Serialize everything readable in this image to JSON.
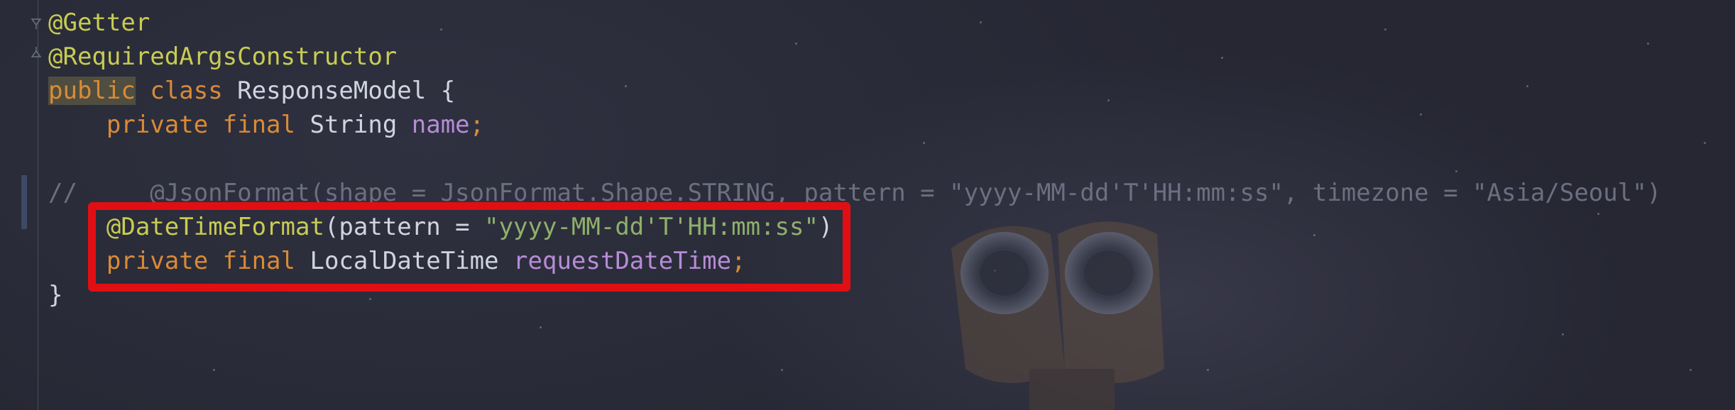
{
  "editor": {
    "lines": [
      [
        {
          "t": "@Getter",
          "c": "ann"
        }
      ],
      [
        {
          "t": "@RequiredArgsConstructor",
          "c": "ann"
        }
      ],
      [
        {
          "t": "public",
          "c": "kw kw-hl"
        },
        {
          "t": " ",
          "c": "plain"
        },
        {
          "t": "class",
          "c": "kw"
        },
        {
          "t": " ResponseModel {",
          "c": "plain"
        }
      ],
      [
        {
          "t": "    ",
          "c": "plain"
        },
        {
          "t": "private final",
          "c": "kw"
        },
        {
          "t": " String ",
          "c": "plain"
        },
        {
          "t": "name",
          "c": "fld"
        },
        {
          "t": ";",
          "c": "kw"
        }
      ],
      [
        {
          "t": "",
          "c": "plain"
        }
      ],
      [
        {
          "t": "//     @JsonFormat(shape = JsonFormat.Shape.STRING, pattern = \"yyyy-MM-dd'T'HH:mm:ss\", timezone = \"Asia/Seoul\")",
          "c": "cmt"
        }
      ],
      [
        {
          "t": "    ",
          "c": "plain"
        },
        {
          "t": "@DateTimeFormat",
          "c": "ann"
        },
        {
          "t": "(pattern = ",
          "c": "plain"
        },
        {
          "t": "\"yyyy-MM-dd'T'HH:mm:ss\"",
          "c": "str"
        },
        {
          "t": ")",
          "c": "plain"
        }
      ],
      [
        {
          "t": "    ",
          "c": "plain"
        },
        {
          "t": "private final",
          "c": "kw"
        },
        {
          "t": " LocalDateTime ",
          "c": "plain"
        },
        {
          "t": "requestDateTime",
          "c": "fld"
        },
        {
          "t": ";",
          "c": "kw"
        }
      ],
      [
        {
          "t": "}",
          "c": "plain"
        }
      ]
    ]
  },
  "colors": {
    "highlight_box": "#e10f13",
    "annotation": "#c8cc52",
    "keyword": "#d98b37",
    "field": "#b68cd6",
    "string": "#8fb06a",
    "comment": "#6b6f80"
  },
  "icons": {
    "fold_open": "fold-open-icon",
    "fold_close": "fold-close-icon"
  }
}
